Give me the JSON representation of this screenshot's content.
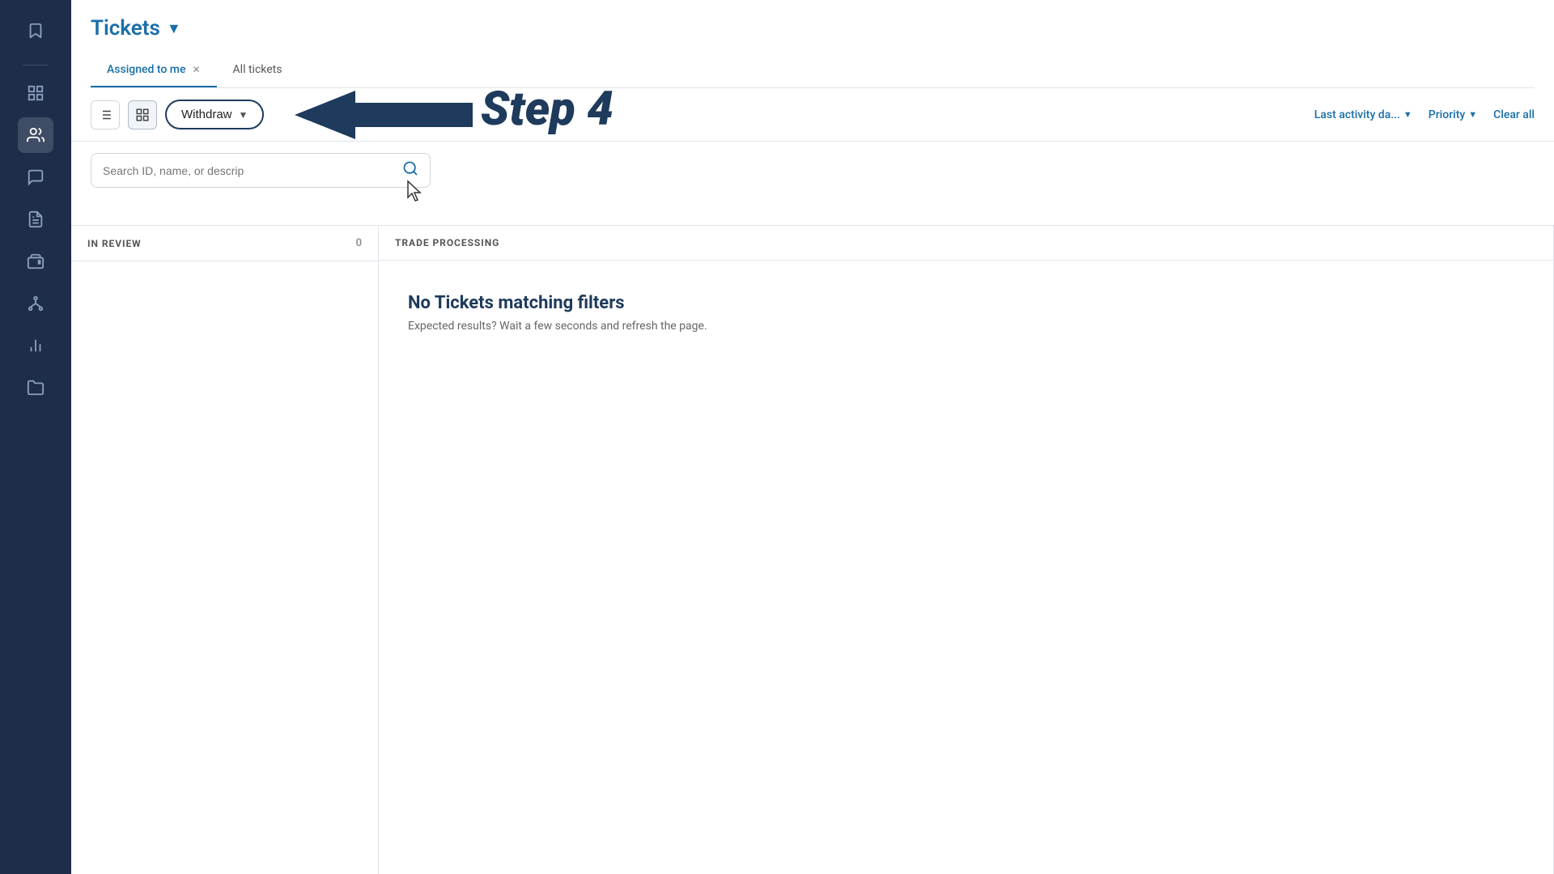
{
  "sidebar": {
    "icons": [
      {
        "name": "bookmark-icon",
        "symbol": "🔖",
        "active": false
      },
      {
        "name": "divider",
        "type": "divider"
      },
      {
        "name": "grid-icon",
        "symbol": "⊞",
        "active": false
      },
      {
        "name": "contacts-icon",
        "symbol": "👤",
        "active": true
      },
      {
        "name": "chat-icon",
        "symbol": "💬",
        "active": false
      },
      {
        "name": "reports-icon",
        "symbol": "📋",
        "active": false
      },
      {
        "name": "wallet-icon",
        "symbol": "👛",
        "active": false
      },
      {
        "name": "org-icon",
        "symbol": "⚙",
        "active": false
      },
      {
        "name": "analytics-icon",
        "symbol": "📊",
        "active": false
      },
      {
        "name": "folder-icon",
        "symbol": "📁",
        "active": false
      }
    ]
  },
  "header": {
    "title": "Tickets",
    "title_chevron": "▼"
  },
  "tabs": [
    {
      "label": "Assigned to me",
      "closable": true,
      "active": true
    },
    {
      "label": "All tickets",
      "closable": false,
      "active": false
    }
  ],
  "toolbar": {
    "list_view_label": "≡",
    "grid_view_label": "⊞",
    "withdraw_label": "Withdraw",
    "withdraw_chevron": "▼",
    "last_activity_label": "Last activity da...",
    "last_activity_chevron": "▼",
    "priority_label": "Priority",
    "priority_chevron": "▼",
    "clear_all_label": "Clear all"
  },
  "step_annotation": {
    "label": "Step 4"
  },
  "search": {
    "placeholder": "Search ID, name, or descrip"
  },
  "columns": [
    {
      "title": "IN REVIEW",
      "count": 0,
      "show_count": true
    },
    {
      "title": "TRADE PROCESSING",
      "count": null,
      "show_count": false
    }
  ],
  "no_tickets": {
    "title": "No T",
    "subtitle_line1": "filte",
    "body_line1": "Expec",
    "body_line2": "few se"
  },
  "colors": {
    "primary_blue": "#1a6fa8",
    "dark_navy": "#1e3a5c",
    "sidebar_bg": "#1e2d4a"
  }
}
